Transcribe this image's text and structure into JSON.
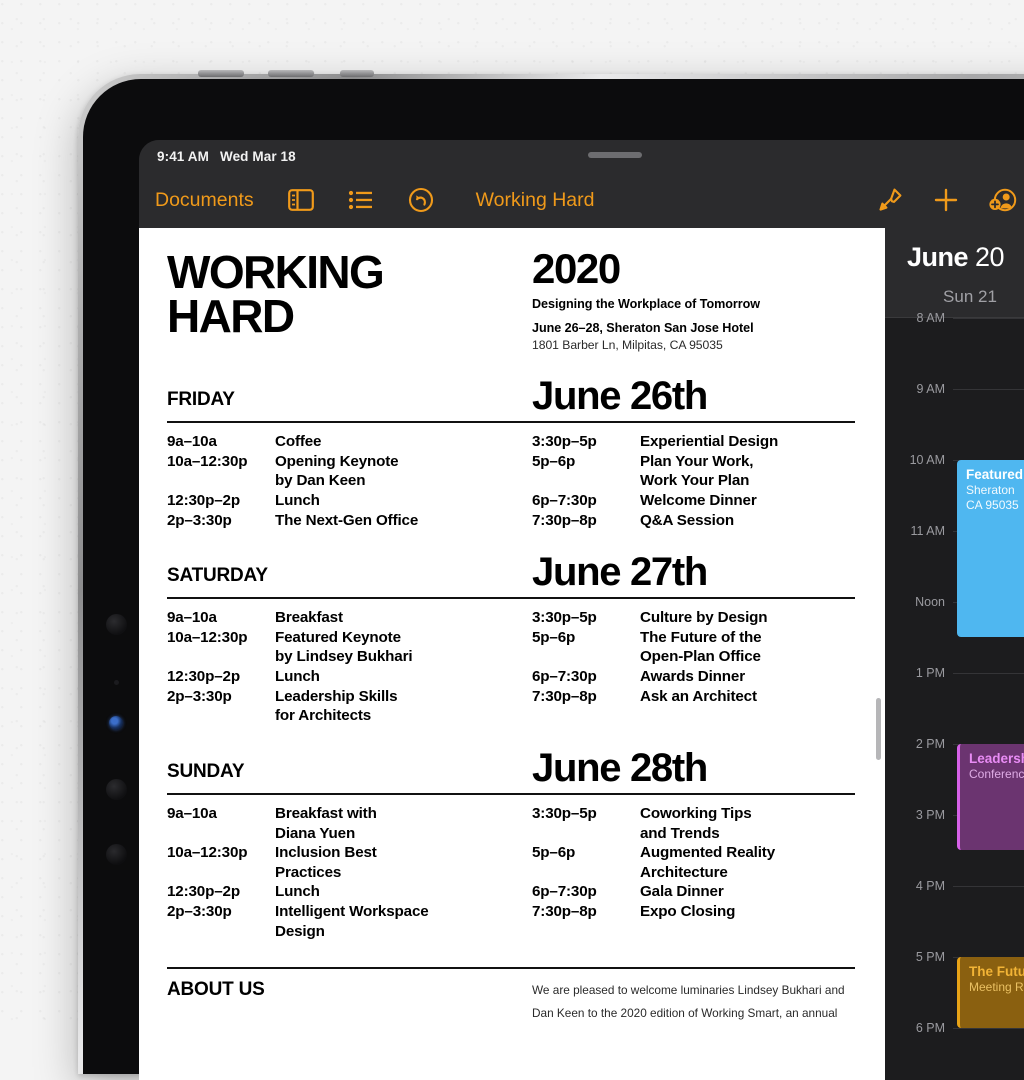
{
  "status_bar": {
    "time": "9:41 AM",
    "date": "Wed Mar 18"
  },
  "toolbar": {
    "documents_label": "Documents",
    "doc_title": "Working Hard",
    "icons": {
      "view_options": "sidebar-icon",
      "list": "list-icon",
      "undo": "undo-icon",
      "format": "brush-icon",
      "insert": "plus-icon",
      "collaborate": "add-person-icon",
      "more": "ellipsis-icon"
    }
  },
  "document": {
    "title_line1": "WORKING",
    "title_line2": "HARD",
    "year": "2020",
    "tagline": "Designing the Workplace of Tomorrow",
    "venue": "June 26–28, Sheraton San Jose Hotel",
    "address": "1801 Barber Ln, Milpitas, CA 95035",
    "days": [
      {
        "name": "FRIDAY",
        "date": "June 26th",
        "left": {
          "times": [
            "9a–10a",
            "10a–12:30p",
            "",
            "12:30p–2p",
            "2p–3:30p"
          ],
          "items": [
            "Coffee",
            "Opening Keynote",
            "by Dan Keen",
            "Lunch",
            "The Next-Gen Office"
          ]
        },
        "right": {
          "times": [
            "3:30p–5p",
            "5p–6p",
            "",
            "6p–7:30p",
            "7:30p–8p"
          ],
          "items": [
            "Experiential Design",
            "Plan Your Work,",
            "Work Your Plan",
            "Welcome Dinner",
            "Q&A Session"
          ]
        }
      },
      {
        "name": "SATURDAY",
        "date": "June 27th",
        "left": {
          "times": [
            "9a–10a",
            "10a–12:30p",
            "",
            "12:30p–2p",
            "2p–3:30p",
            ""
          ],
          "items": [
            "Breakfast",
            "Featured Keynote",
            "by Lindsey Bukhari",
            "Lunch",
            "Leadership Skills",
            "for Architects"
          ]
        },
        "right": {
          "times": [
            "3:30p–5p",
            "5p–6p",
            "",
            "6p–7:30p",
            "7:30p–8p",
            ""
          ],
          "items": [
            "Culture by Design",
            "The Future of the",
            "Open-Plan Office",
            "Awards Dinner",
            "Ask an Architect",
            ""
          ]
        }
      },
      {
        "name": "SUNDAY",
        "date": "June 28th",
        "left": {
          "times": [
            "9a–10a",
            "",
            "10a–12:30p",
            "",
            "12:30p–2p",
            "2p–3:30p",
            ""
          ],
          "items": [
            "Breakfast with",
            "Diana Yuen",
            "Inclusion Best",
            "Practices",
            "Lunch",
            "Intelligent Workspace",
            "Design"
          ]
        },
        "right": {
          "times": [
            "3:30p–5p",
            "",
            "5p–6p",
            "",
            "6p–7:30p",
            "7:30p–8p",
            ""
          ],
          "items": [
            "Coworking Tips",
            "and Trends",
            "Augmented Reality",
            "Architecture",
            "Gala Dinner",
            "Expo Closing",
            ""
          ]
        }
      }
    ],
    "about_heading": "ABOUT US",
    "about_text": "We are pleased to welcome luminaries Lindsey Bukhari and Dan Keen to the 2020 edition of Working Smart, an annual"
  },
  "calendar": {
    "month_bold": "June",
    "month_year": " 20",
    "day_label": "Sun 21",
    "hours": [
      "8 AM",
      "9 AM",
      "10 AM",
      "11 AM",
      "Noon",
      "1 PM",
      "2 PM",
      "3 PM",
      "4 PM",
      "5 PM",
      "6 PM"
    ],
    "events": [
      {
        "title": "Featured",
        "sub1": "Sheraton",
        "sub2": "CA  95035",
        "color": "#4fb7f0"
      },
      {
        "title": "Leadersh",
        "sub1": "Conferenc",
        "sub2": "",
        "color": "#6b3470"
      },
      {
        "title": "The Futu",
        "sub1": "Meeting R",
        "sub2": "",
        "color": "#8a6010"
      }
    ]
  },
  "theme": {
    "accent": "#f09a1a",
    "chrome": "#2b2b2d",
    "calendar_bg": "#1c1c1e",
    "page_bg": "#f4f4f4"
  }
}
